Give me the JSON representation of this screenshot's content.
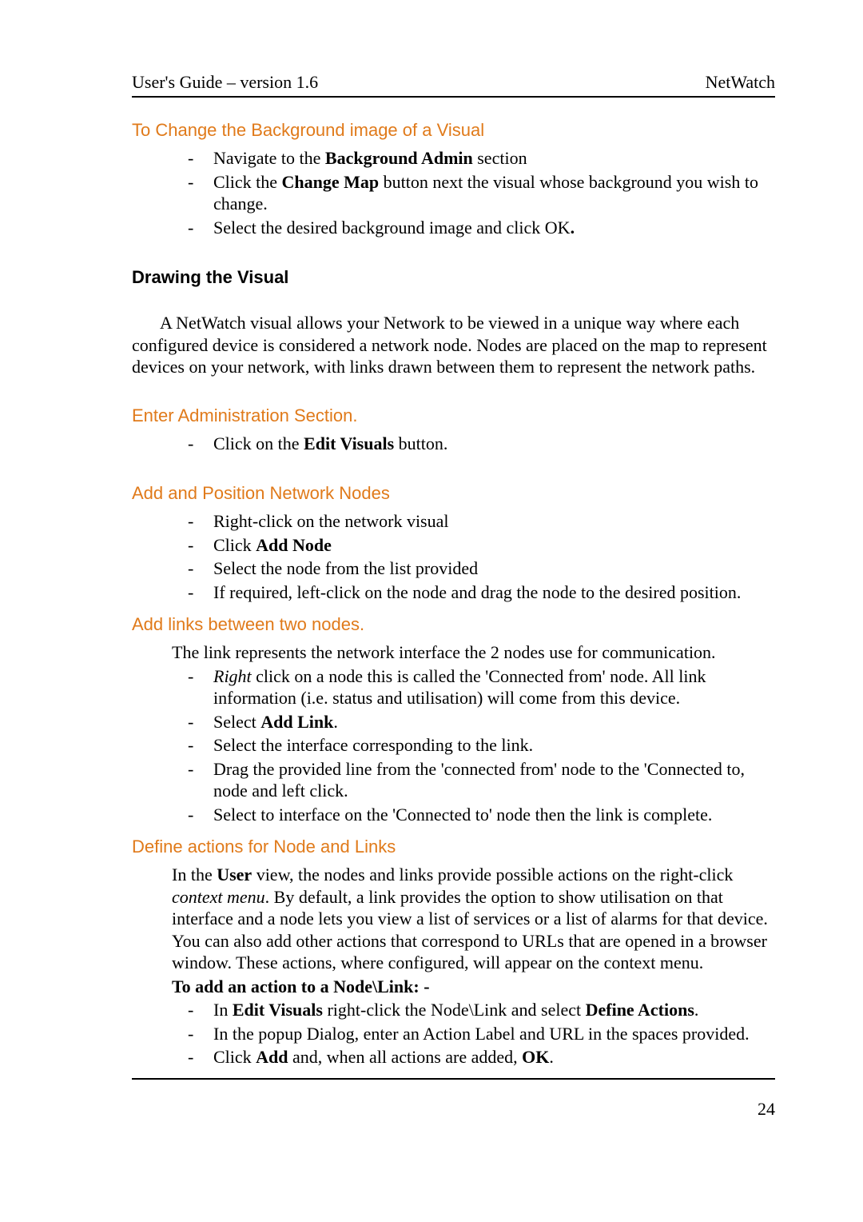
{
  "header": {
    "left": "User's Guide – version 1.6",
    "right": "NetWatch"
  },
  "s1": {
    "heading": "To Change the Background image of a Visual",
    "b1a": "Navigate to the ",
    "b1b": "Background Admin",
    "b1c": " section",
    "b2a": "Click the ",
    "b2b": "Change Map",
    "b2c": " button next the visual whose background you wish to change.",
    "b3a": "Select the desired background image and click OK",
    "b3b": "."
  },
  "s2": {
    "heading": "Drawing the Visual",
    "para": "A NetWatch visual allows your Network to be viewed in a unique way where each configured device is considered a network node.  Nodes are placed on the map to represent devices on your network, with links drawn between them to represent the network paths."
  },
  "s3": {
    "heading": "Enter Administration Section.",
    "b1a": "Click on the ",
    "b1b": "Edit Visuals",
    "b1c": " button."
  },
  "s4": {
    "heading": "Add and Position Network Nodes",
    "b1": "Right-click on the network visual",
    "b2a": "Click ",
    "b2b": "Add Node",
    "b3": "Select the node from the list provided",
    "b4": "If required, left-click on the node and drag the node to the desired position."
  },
  "s5": {
    "heading": "Add links between two nodes.",
    "intro": "The link represents the network interface the 2 nodes use for communication.",
    "b1a": "Right",
    "b1b": " click on a node this is called the 'Connected from' node. All link information (i.e. status and utilisation) will come from this device.",
    "b2a": "Select ",
    "b2b": "Add Link",
    "b2c": ".",
    "b3": "Select the interface corresponding to the link.",
    "b4": "Drag the provided line from the 'connected from' node to the 'Connected to, node and left click.",
    "b5": "Select to interface on the 'Connected to' node then the link is complete."
  },
  "s6": {
    "heading": "Define actions for Node and Links",
    "p1a": "In the ",
    "p1b": "User",
    "p1c": " view, the nodes and links provide possible actions on the right-click ",
    "p1d": "context menu",
    "p1e": ". By default, a link provides the option to show utilisation on that interface and a node lets you view a list of services or a list of alarms for that device. You can also add other actions that correspond to URLs that are opened in a browser window. These actions, where configured, will appear on the context menu.",
    "sub": "To add an action to a Node\\Link: -",
    "b1a": "In ",
    "b1b": "Edit Visuals",
    "b1c": " right-click the Node\\Link and select ",
    "b1d": "Define Actions",
    "b1e": ".",
    "b2": "In the popup Dialog, enter an Action Label and URL in the spaces provided.",
    "b3a": "Click ",
    "b3b": "Add",
    "b3c": " and, when all actions are added, ",
    "b3d": "OK",
    "b3e": "."
  },
  "pagenum": "24",
  "dash": "-"
}
